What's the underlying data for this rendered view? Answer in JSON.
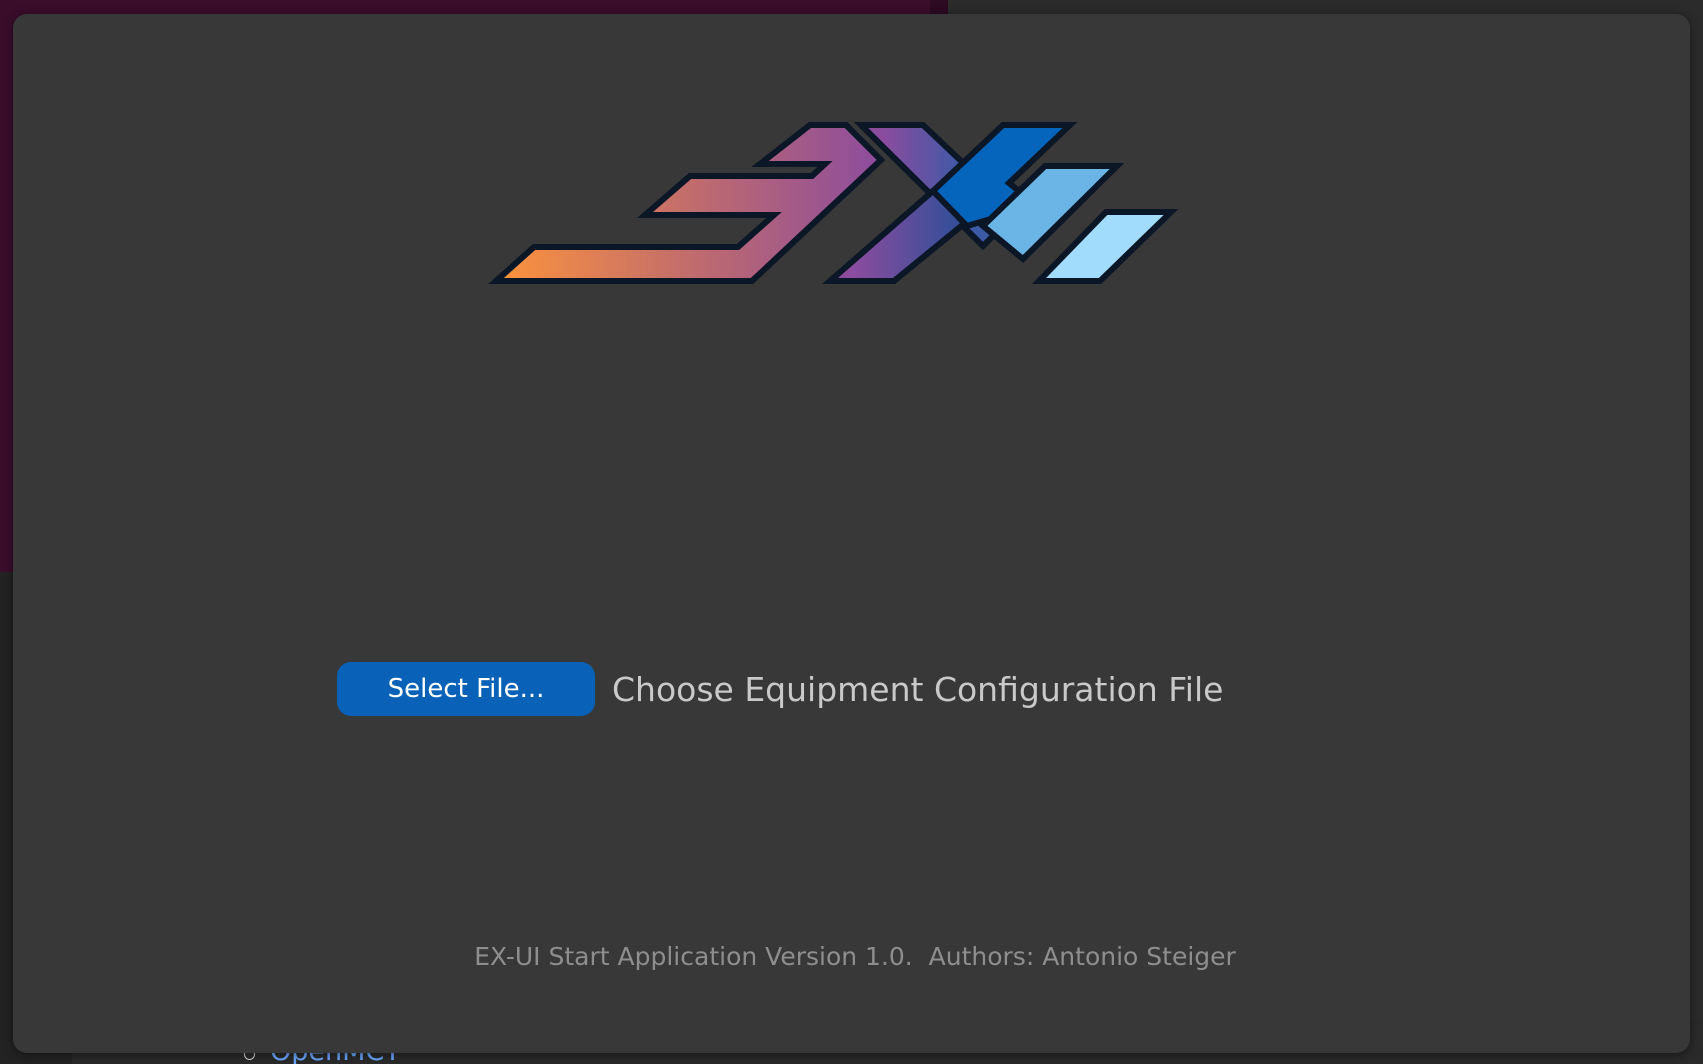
{
  "background": {
    "peek_link_text": "OpenMCT"
  },
  "app": {
    "logo_icon": "exui-logo-icon",
    "select_file_button": "Select File...",
    "file_prompt": "Choose Equipment Configuration File",
    "footer_text": "EX-UI Start Application Version 1.0.  Authors: Antonio Steiger"
  },
  "colors": {
    "window_bg": "#383838",
    "button_bg": "#0a62b8",
    "logo_orange": "#f9913f",
    "logo_purple": "#8b4c9e",
    "logo_blue": "#0565bd",
    "logo_light_blue": "#a2dcfd",
    "logo_outline": "#0b1626"
  }
}
